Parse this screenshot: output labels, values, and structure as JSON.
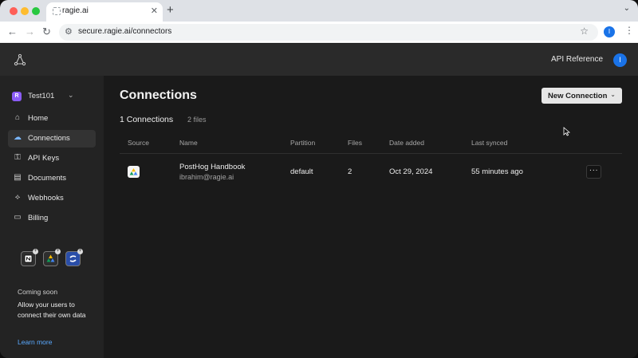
{
  "browser": {
    "tab_title": "ragie.ai",
    "url": "secure.ragie.ai/connectors",
    "profile_initial": "I"
  },
  "header": {
    "api_reference": "API Reference",
    "user_initial": "I"
  },
  "sidebar": {
    "workspace_badge": "R",
    "workspace_name": "Test101",
    "items": [
      {
        "label": "Home",
        "icon": "home-icon"
      },
      {
        "label": "Connections",
        "icon": "cloud-icon",
        "active": true
      },
      {
        "label": "API Keys",
        "icon": "key-icon"
      },
      {
        "label": "Documents",
        "icon": "document-icon"
      },
      {
        "label": "Webhooks",
        "icon": "webhook-icon"
      },
      {
        "label": "Billing",
        "icon": "card-icon"
      }
    ],
    "coming_soon_title": "Coming soon",
    "coming_soon_body": "Allow your users to connect their own data",
    "learn_more": "Learn more"
  },
  "main": {
    "title": "Connections",
    "new_connection": "New Connection",
    "count_label": "1 Connections",
    "files_label": "2 files",
    "columns": [
      "Source",
      "Name",
      "Partition",
      "Files",
      "Date added",
      "Last synced"
    ],
    "rows": [
      {
        "source_icon": "google-drive-icon",
        "name": "PostHog Handbook",
        "email": "ibrahim@ragie.ai",
        "partition": "default",
        "files": "2",
        "date_added": "Oct 29, 2024",
        "last_synced": "55 minutes ago"
      }
    ]
  },
  "colors": {
    "accent": "#1a73e8",
    "workspace": "#8b5cf6",
    "link": "#5aa9ff"
  }
}
